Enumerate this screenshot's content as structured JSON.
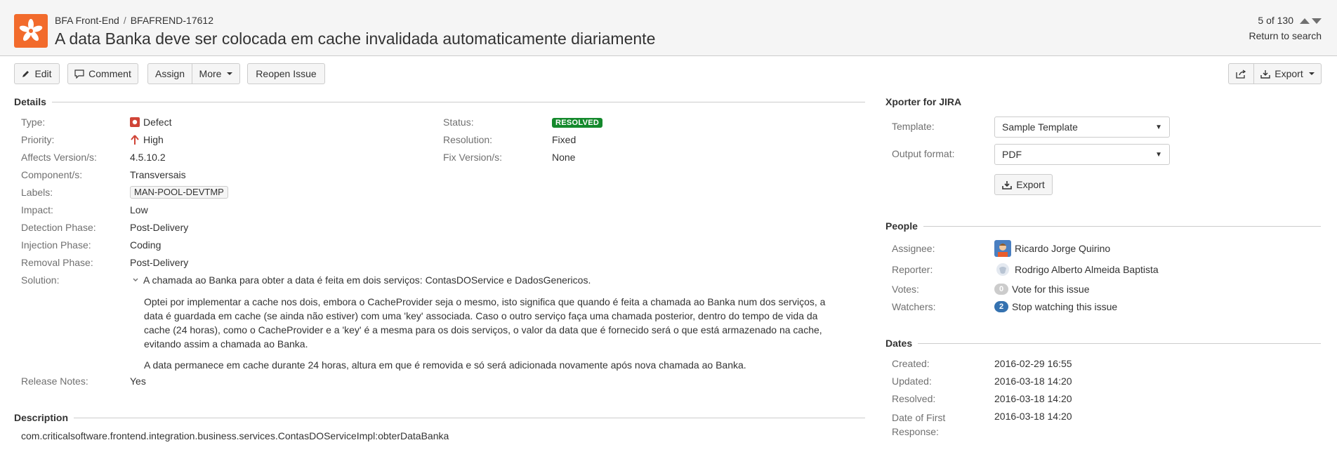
{
  "header": {
    "project": "BFA Front-End",
    "issue_key": "BFAFREND-17612",
    "title": "A data Banka deve ser colocada em cache invalidada automaticamente diariamente",
    "pager": "5 of 130",
    "return_link": "Return to search"
  },
  "toolbar": {
    "edit": "Edit",
    "comment": "Comment",
    "assign": "Assign",
    "more": "More",
    "reopen": "Reopen Issue",
    "export": "Export"
  },
  "details": {
    "heading": "Details",
    "left": [
      {
        "label": "Type:",
        "value": "Defect"
      },
      {
        "label": "Priority:",
        "value": "High"
      },
      {
        "label": "Affects Version/s:",
        "value": "4.5.10.2"
      },
      {
        "label": "Component/s:",
        "value": "Transversais"
      },
      {
        "label": "Labels:",
        "value": "MAN-POOL-DEVTMP"
      },
      {
        "label": "Impact:",
        "value": "Low"
      },
      {
        "label": "Detection Phase:",
        "value": "Post-Delivery"
      },
      {
        "label": "Injection Phase:",
        "value": "Coding"
      },
      {
        "label": "Removal Phase:",
        "value": "Post-Delivery"
      },
      {
        "label": "Solution:",
        "value": "A chamada ao Banka para obter a data é feita em dois serviços: ContasDOService e DadosGenericos."
      },
      {
        "label": "Release Notes:",
        "value": "Yes"
      }
    ],
    "right": [
      {
        "label": "Status:",
        "value": "RESOLVED"
      },
      {
        "label": "Resolution:",
        "value": "Fixed"
      },
      {
        "label": "Fix Version/s:",
        "value": "None"
      }
    ],
    "solution_paragraphs": [
      "Optei por implementar a cache nos dois, embora o CacheProvider seja o mesmo, isto significa que quando é feita a chamada ao Banka num dos serviços, a data é guardada em cache (se ainda não estiver) com uma 'key' associada. Caso o outro serviço faça uma chamada posterior, dentro do tempo de vida da cache (24 horas), como o CacheProvider e a 'key' é a mesma para os dois serviços, o valor da data que é fornecido será o que está armazenado na cache, evitando assim a chamada ao Banka.",
      "A data permanece em cache durante 24 horas, altura em que é removida e só será adicionada novamente após nova chamada ao Banka."
    ]
  },
  "description": {
    "heading": "Description",
    "text": "com.criticalsoftware.frontend.integration.business.services.ContasDOServiceImpl:obterDataBanka"
  },
  "xporter": {
    "heading": "Xporter for JIRA",
    "template_label": "Template:",
    "template_value": "Sample Template",
    "format_label": "Output format:",
    "format_value": "PDF",
    "export_button": "Export"
  },
  "people": {
    "heading": "People",
    "assignee_label": "Assignee:",
    "assignee": "Ricardo Jorge Quirino",
    "reporter_label": "Reporter:",
    "reporter": "Rodrigo Alberto Almeida Baptista",
    "votes_label": "Votes:",
    "votes_count": "0",
    "votes_link": "Vote for this issue",
    "watchers_label": "Watchers:",
    "watchers_count": "2",
    "watchers_link": "Stop watching this issue"
  },
  "dates": {
    "heading": "Dates",
    "items": [
      {
        "label": "Created:",
        "value": "2016-02-29 16:55"
      },
      {
        "label": "Updated:",
        "value": "2016-03-18 14:20"
      },
      {
        "label": "Resolved:",
        "value": "2016-03-18 14:20"
      },
      {
        "label": "Date of First Response:",
        "value": "2016-03-18 14:20"
      }
    ]
  },
  "colors": {
    "project_avatar": "#f26b2c",
    "resolved_lozenge": "#14892c",
    "defect_icon": "#d04437",
    "priority_high": "#d04437",
    "watchers_badge": "#3572b0"
  },
  "icons": {
    "project": "project-flower-icon",
    "edit": "pencil-icon",
    "comment": "speech-bubble-icon",
    "share": "share-icon",
    "export": "download-icon",
    "defect": "defect-icon",
    "priority": "arrow-up-icon",
    "solution_toggle": "chevron-down-icon"
  }
}
